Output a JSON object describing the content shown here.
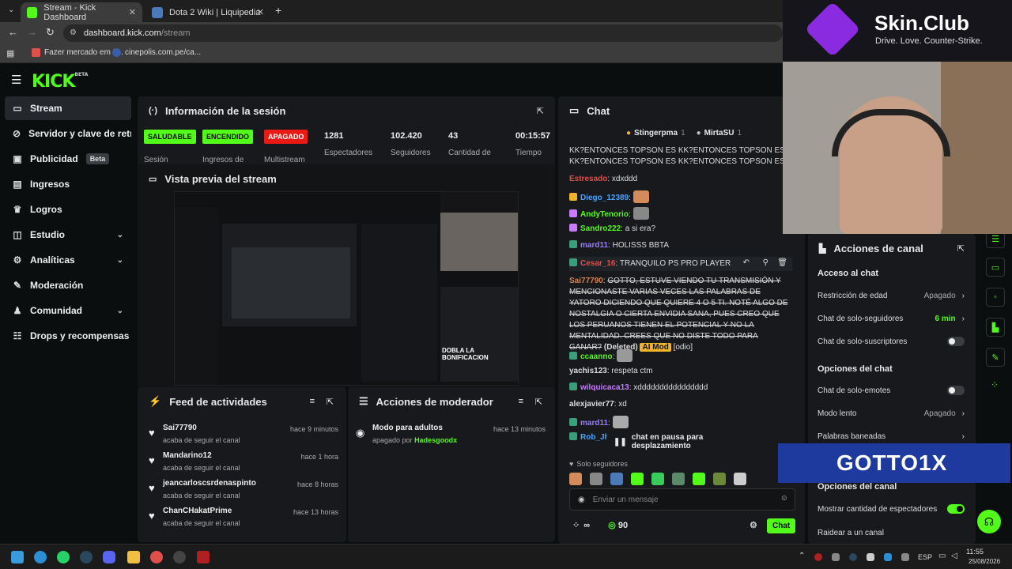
{
  "browser": {
    "tabs": [
      {
        "title": "Stream - Kick Dashboard",
        "active": true
      },
      {
        "title": "Dota 2 Wiki | Liquipedia",
        "active": false
      }
    ],
    "new_tab": "+",
    "url_domain": "dashboard.kick.com",
    "url_path": "/stream",
    "bookmarks": [
      "Fazer mercado em F...",
      "cinepolis.com.pe/ca..."
    ]
  },
  "app": {
    "logo": "KICK",
    "logo_sup": "BETA",
    "sidebar": [
      {
        "label": "Stream",
        "icon": "stream-icon",
        "active": true
      },
      {
        "label": "Servidor y clave de retransmisión",
        "icon": "key-icon"
      },
      {
        "label": "Publicidad",
        "icon": "ad-icon",
        "badge": "Beta"
      },
      {
        "label": "Ingresos",
        "icon": "money-icon"
      },
      {
        "label": "Logros",
        "icon": "trophy-icon"
      },
      {
        "label": "Estudio",
        "icon": "studio-icon",
        "chevron": true
      },
      {
        "label": "Analíticas",
        "icon": "analytics-icon",
        "chevron": true
      },
      {
        "label": "Moderación",
        "icon": "moderation-icon"
      },
      {
        "label": "Comunidad",
        "icon": "community-icon",
        "chevron": true
      },
      {
        "label": "Drops y recompensas",
        "icon": "drops-icon"
      }
    ]
  },
  "session": {
    "title": "Información de la sesión",
    "stats": [
      {
        "pill": "SALUDABLE",
        "pill_color": "#53fc18",
        "label": "Sesión"
      },
      {
        "pill": "ENCENDIDO",
        "pill_color": "#53fc18",
        "label": "Ingresos de"
      },
      {
        "pill": "APAGADO",
        "pill_color": "#e91916",
        "label": "Multistream"
      },
      {
        "value": "1281",
        "label": "Espectadores"
      },
      {
        "value": "102.420",
        "label": "Seguidores"
      },
      {
        "value": "43",
        "label": "Cantidad de"
      },
      {
        "value": "00:15:57",
        "label": "Tiempo"
      }
    ]
  },
  "preview": {
    "title": "Vista previa del stream",
    "overlay_text": "DOBLA LA BONIFICACION"
  },
  "feed": {
    "title": "Feed de actividades",
    "items": [
      {
        "name": "Sai77790",
        "action": "acaba de seguir el canal",
        "time": "hace 9 minutos"
      },
      {
        "name": "Mandarino12",
        "action": "acaba de seguir el canal",
        "time": "hace 1 hora"
      },
      {
        "name": "jeancarloscsrdenaspinto",
        "action": "acaba de seguir el canal",
        "time": "hace 8 horas"
      },
      {
        "name": "ChanCHakatPrime",
        "action": "acaba de seguir el canal",
        "time": "hace 13 horas"
      }
    ]
  },
  "modactions": {
    "title": "Acciones de moderador",
    "items": [
      {
        "title": "Modo para adultos",
        "sub_prefix": "apagado por",
        "user": "Hadesgoodx",
        "time": "hace 13 minutos"
      }
    ]
  },
  "chat": {
    "title": "Chat",
    "pinned": [
      "Stingerpma",
      "1",
      "MirtaSU",
      "1"
    ],
    "spam_text": "KK?ENTONCES TOPSON ES KK?ENTONCES TOPSON ES KK?ENTONCES TOPSON ES KK?ENTONCES TOPSON ES KK?",
    "messages": [
      {
        "user": "Estresado",
        "color": "#e0504a",
        "text": "xdxddd"
      },
      {
        "user": "Diego_12389",
        "color": "#4aa3ff",
        "text": ""
      },
      {
        "user": "AndyTenorio",
        "color": "#53fc18",
        "text": ""
      },
      {
        "user": "Sandro222",
        "color": "#53fc18",
        "text": "a si era?"
      },
      {
        "user": "mard11",
        "color": "#9b7bff",
        "text": "HOLISSS BBTA"
      },
      {
        "user": "Cesar_16",
        "color": "#e0504a",
        "text": "TRANQUILO PS PRO PLAYER"
      },
      {
        "user": "Sai77790",
        "color": "#e0804a",
        "text": "GOTTO, ESTUVE VIENDO TU TRANSMISIÓN Y MENCIONASTE VARIAS VECES LAS PALABRAS DE YATORO DICIENDO QUE QUIERE 4 O 5 TI. NOTÉ ALGO DE NOSTALGIA O CIERTA ENVIDIA SANA, PUES CREO QUE LOS PERUANOS TIENEN EL POTENCIAL Y NO LA MENTALIDAD. CREES QUE NO DISTE TODO PARA GANAR?",
        "deleted": "(Deleted)",
        "ai": "AI Mod",
        "tag": "[odio]"
      },
      {
        "user": "ccaanno",
        "color": "#53fc18",
        "text": ""
      },
      {
        "user": "yachis123",
        "color": "#e8e8e8",
        "text": "respeta ctm"
      },
      {
        "user": "wilquicaca13",
        "color": "#c77bff",
        "text": "xdddddddddddddddd"
      },
      {
        "user": "alexjavier77",
        "color": "#e8e8e8",
        "text": "xd"
      },
      {
        "user": "mard11",
        "color": "#9b7bff",
        "text": ""
      },
      {
        "user": "Rob_Jh",
        "color": "#4aa3ff",
        "text": ""
      }
    ],
    "paused": "chat en pausa para desplazamiento",
    "followers_only": "Solo seguidores",
    "input_placeholder": "Enviar un mensaje",
    "infinity": "∞",
    "points": "90",
    "send": "Chat"
  },
  "channel_actions": {
    "title": "Acciones de canal",
    "sections": [
      {
        "heading": "Acceso al chat",
        "rows": [
          {
            "label": "Restricción de edad",
            "value": "Apagado",
            "type": "chevron"
          },
          {
            "label": "Chat de solo-seguidores",
            "value": "6 min",
            "value_color": "#53fc18",
            "type": "chevron"
          },
          {
            "label": "Chat de solo-suscriptores",
            "type": "toggle",
            "on": false
          }
        ]
      },
      {
        "heading": "Opciones del chat",
        "rows": [
          {
            "label": "Chat de solo-emotes",
            "type": "toggle",
            "on": false
          },
          {
            "label": "Modo lento",
            "value": "Apagado",
            "type": "chevron"
          },
          {
            "label": "Palabras baneadas",
            "type": "chevron"
          }
        ]
      },
      {
        "heading": "Opciones del canal",
        "rows": [
          {
            "label": "Mostrar cantidad de espectadores",
            "type": "toggle",
            "on": true
          },
          {
            "label": "Raidear a un canal",
            "type": "none"
          }
        ]
      }
    ]
  },
  "overlays": {
    "brand": "Skin.Club",
    "tagline": "Drive. Love. Counter-Strike.",
    "banner": "GOTTO1X"
  },
  "taskbar": {
    "lang": "ESP",
    "time": "11:55",
    "date": "25/08/2026"
  }
}
